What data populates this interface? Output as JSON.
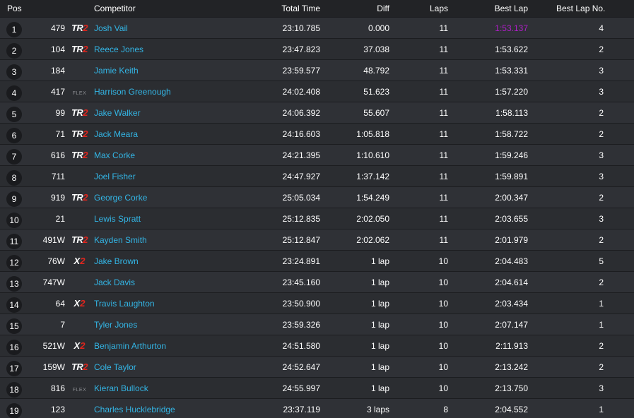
{
  "headers": {
    "pos": "Pos",
    "competitor": "Competitor",
    "total_time": "Total Time",
    "diff": "Diff",
    "laps": "Laps",
    "best_lap": "Best Lap",
    "best_lap_no": "Best Lap No."
  },
  "colors": {
    "background": "#2b2d31",
    "name_link": "#33b5e5",
    "fastest_lap": "#b01ec8",
    "logo_accent": "#e0261e"
  },
  "rows": [
    {
      "pos": "1",
      "num": "479",
      "logo": "TR2",
      "name": "Josh Vail",
      "total": "23:10.785",
      "diff": "0.000",
      "laps": "11",
      "best": "1:53.137",
      "best_no": "4",
      "fastest": true
    },
    {
      "pos": "2",
      "num": "104",
      "logo": "TR2",
      "name": "Reece Jones",
      "total": "23:47.823",
      "diff": "37.038",
      "laps": "11",
      "best": "1:53.622",
      "best_no": "2"
    },
    {
      "pos": "3",
      "num": "184",
      "logo": "",
      "name": "Jamie Keith",
      "total": "23:59.577",
      "diff": "48.792",
      "laps": "11",
      "best": "1:53.331",
      "best_no": "3"
    },
    {
      "pos": "4",
      "num": "417",
      "logo": "FLEX",
      "name": "Harrison Greenough",
      "total": "24:02.408",
      "diff": "51.623",
      "laps": "11",
      "best": "1:57.220",
      "best_no": "3"
    },
    {
      "pos": "5",
      "num": "99",
      "logo": "TR2",
      "name": "Jake Walker",
      "total": "24:06.392",
      "diff": "55.607",
      "laps": "11",
      "best": "1:58.113",
      "best_no": "2"
    },
    {
      "pos": "6",
      "num": "71",
      "logo": "TR2",
      "name": "Jack Meara",
      "total": "24:16.603",
      "diff": "1:05.818",
      "laps": "11",
      "best": "1:58.722",
      "best_no": "2"
    },
    {
      "pos": "7",
      "num": "616",
      "logo": "TR2",
      "name": "Max Corke",
      "total": "24:21.395",
      "diff": "1:10.610",
      "laps": "11",
      "best": "1:59.246",
      "best_no": "3"
    },
    {
      "pos": "8",
      "num": "711",
      "logo": "",
      "name": "Joel Fisher",
      "total": "24:47.927",
      "diff": "1:37.142",
      "laps": "11",
      "best": "1:59.891",
      "best_no": "3"
    },
    {
      "pos": "9",
      "num": "919",
      "logo": "TR2",
      "name": "George Corke",
      "total": "25:05.034",
      "diff": "1:54.249",
      "laps": "11",
      "best": "2:00.347",
      "best_no": "2"
    },
    {
      "pos": "10",
      "num": "21",
      "logo": "",
      "name": "Lewis Spratt",
      "total": "25:12.835",
      "diff": "2:02.050",
      "laps": "11",
      "best": "2:03.655",
      "best_no": "3"
    },
    {
      "pos": "11",
      "num": "491W",
      "logo": "TR2",
      "name": "Kayden Smith",
      "total": "25:12.847",
      "diff": "2:02.062",
      "laps": "11",
      "best": "2:01.979",
      "best_no": "2"
    },
    {
      "pos": "12",
      "num": "76W",
      "logo": "X2",
      "name": "Jake Brown",
      "total": "23:24.891",
      "diff": "1 lap",
      "laps": "10",
      "best": "2:04.483",
      "best_no": "5"
    },
    {
      "pos": "13",
      "num": "747W",
      "logo": "",
      "name": "Jack Davis",
      "total": "23:45.160",
      "diff": "1 lap",
      "laps": "10",
      "best": "2:04.614",
      "best_no": "2"
    },
    {
      "pos": "14",
      "num": "64",
      "logo": "X2",
      "name": "Travis Laughton",
      "total": "23:50.900",
      "diff": "1 lap",
      "laps": "10",
      "best": "2:03.434",
      "best_no": "1"
    },
    {
      "pos": "15",
      "num": "7",
      "logo": "",
      "name": "Tyler Jones",
      "total": "23:59.326",
      "diff": "1 lap",
      "laps": "10",
      "best": "2:07.147",
      "best_no": "1"
    },
    {
      "pos": "16",
      "num": "521W",
      "logo": "X2",
      "name": "Benjamin Arthurton",
      "total": "24:51.580",
      "diff": "1 lap",
      "laps": "10",
      "best": "2:11.913",
      "best_no": "2"
    },
    {
      "pos": "17",
      "num": "159W",
      "logo": "TR2",
      "name": "Cole Taylor",
      "total": "24:52.647",
      "diff": "1 lap",
      "laps": "10",
      "best": "2:13.242",
      "best_no": "2"
    },
    {
      "pos": "18",
      "num": "816",
      "logo": "FLEX",
      "name": "Kieran Bullock",
      "total": "24:55.997",
      "diff": "1 lap",
      "laps": "10",
      "best": "2:13.750",
      "best_no": "3"
    },
    {
      "pos": "19",
      "num": "123",
      "logo": "",
      "name": "Charles Hucklebridge",
      "total": "23:37.119",
      "diff": "3 laps",
      "laps": "8",
      "best": "2:04.552",
      "best_no": "1"
    }
  ]
}
